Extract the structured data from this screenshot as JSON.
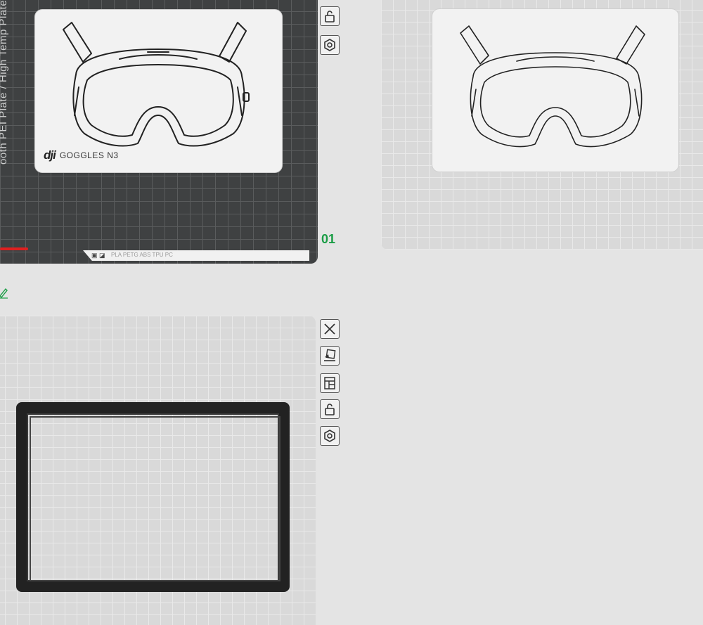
{
  "plates": [
    {
      "id": "plate-1",
      "edge_label": "ooth PEI Plate / High Temp Plate",
      "tab_text": "PLA PETG ABS TPU PC",
      "tab_icons": "▣ ◪",
      "card_brand_mark": "dji",
      "card_brand_name": "GOGGLES N3"
    },
    {
      "id": "plate-2",
      "number": "01"
    },
    {
      "id": "plate-3"
    }
  ],
  "toolbar_labels": {
    "close": "close",
    "auto_arrange": "auto-arrange",
    "layout": "layout",
    "lock": "lock",
    "settings": "settings"
  },
  "colors": {
    "accent_green": "#1a9d45",
    "dark_plate": "#3f4142",
    "light_plate": "#d9d9d9",
    "object_black": "#222222"
  }
}
